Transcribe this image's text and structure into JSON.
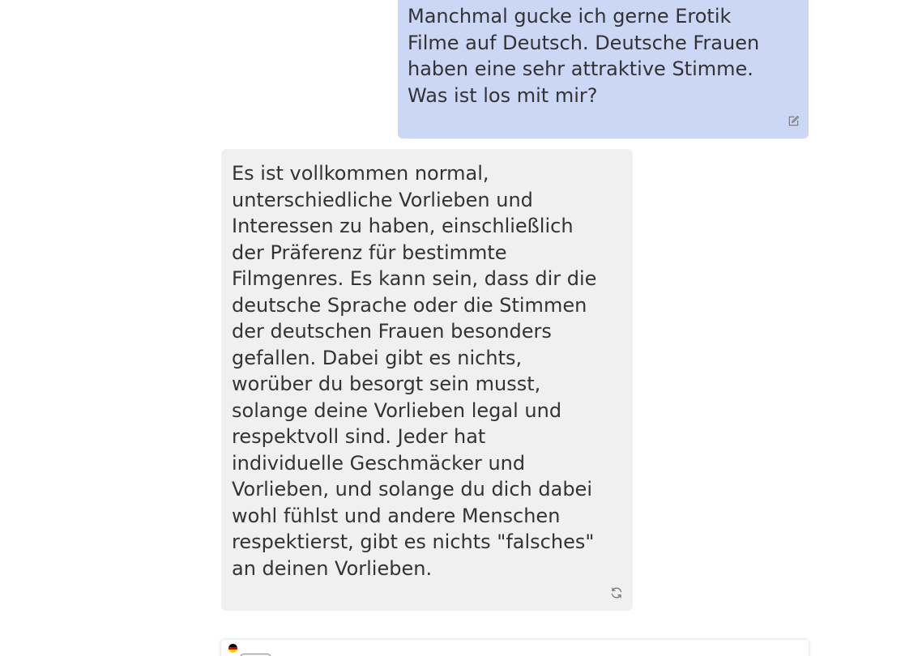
{
  "conversation": {
    "user_message": {
      "text": "Manchmal gucke ich gerne Erotik\nFilme auf Deutsch. Deutsche Frauen\nhaben eine sehr attraktive Stimme.\nWas ist los mit mir?",
      "edit_icon": "edit-icon",
      "background": "#ccd6f5"
    },
    "assistant_message": {
      "text": "Es ist vollkommen normal,\nunterschiedliche Vorlieben und\nInteressen zu haben, einschließlich\nder Präferenz für bestimmte\nFilmgenres. Es kann sein, dass dir die\ndeutsche Sprache oder die Stimmen\nder deutschen Frauen besonders\ngefallen. Dabei gibt es nichts,\nworüber du besorgt sein musst,\nsolange deine Vorlieben legal und\nrespektvoll sind. Jeder hat\nindividuelle Geschmäcker und\nVorlieben, und solange du dich dabei\nwohl fühlst und andere Menschen\nrespektierst, gibt es nichts \"falsches\"\nan deinen Vorlieben.",
      "regenerate_icon": "refresh-icon",
      "background": "#f0f0f0"
    }
  },
  "composer": {
    "language_flag": "germany-flag-icon"
  }
}
